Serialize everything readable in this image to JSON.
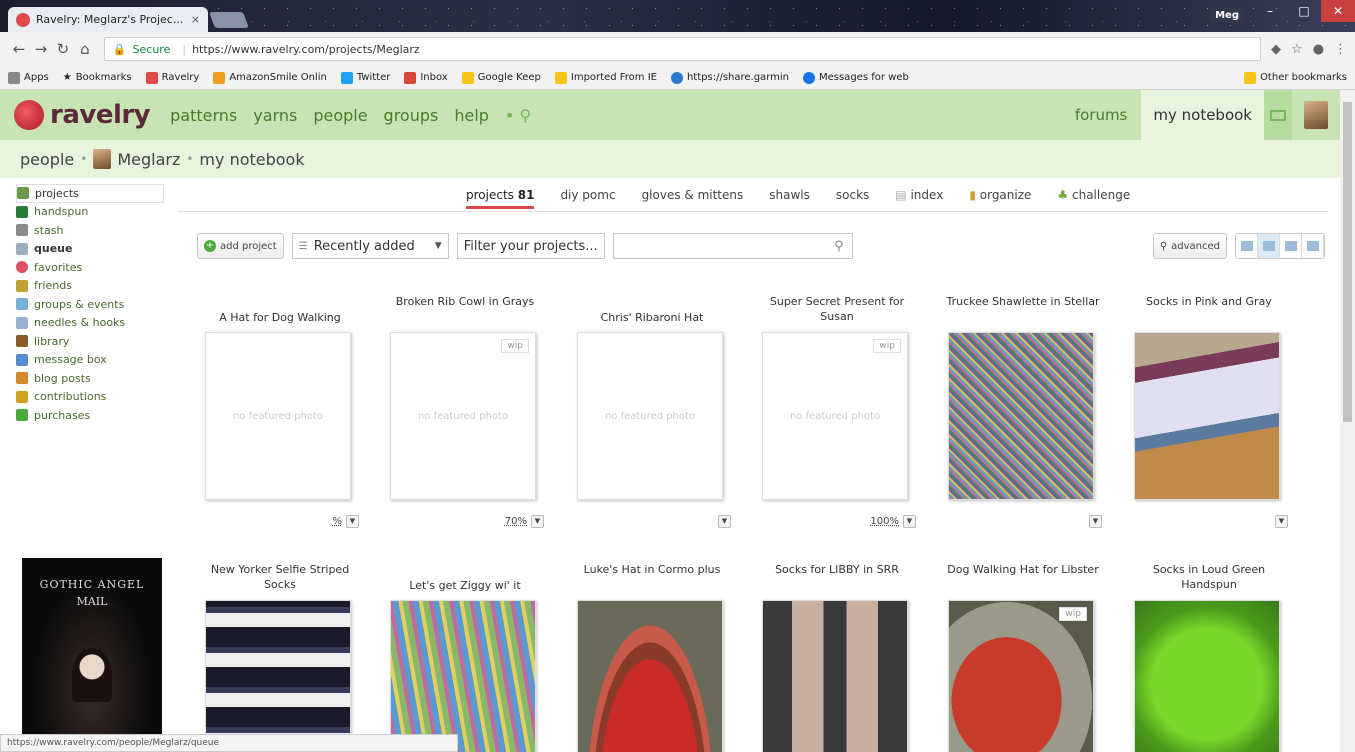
{
  "browser": {
    "tab_title": "Ravelry: Meglarz's Projec...",
    "tab_close": "×",
    "profile": "Meg",
    "secure_label": "Secure",
    "url": "https://www.ravelry.com/projects/Meglarz",
    "bookmarks": [
      {
        "label": "Apps",
        "color": "#888888"
      },
      {
        "label": "Bookmarks",
        "color": "#333333"
      },
      {
        "label": "Ravelry",
        "color": "#e24a4a"
      },
      {
        "label": "AmazonSmile Onlin",
        "color": "#f0a020"
      },
      {
        "label": "Twitter",
        "color": "#1da1f2"
      },
      {
        "label": "Inbox",
        "color": "#d44638"
      },
      {
        "label": "Google Keep",
        "color": "#f5c518"
      },
      {
        "label": "Imported From IE",
        "color": "#f5c518"
      },
      {
        "label": "https://share.garmin",
        "color": "#2a7ad0"
      },
      {
        "label": "Messages for web",
        "color": "#1a73e8"
      }
    ],
    "other_bookmarks": "Other bookmarks",
    "status_url": "https://www.ravelry.com/people/Meglarz/queue"
  },
  "header": {
    "logo": "ravelry",
    "nav": [
      "patterns",
      "yarns",
      "people",
      "groups",
      "help"
    ],
    "forums": "forums",
    "notebook": "my notebook"
  },
  "breadcrumb": {
    "people": "people",
    "user": "Meglarz",
    "notebook": "my notebook"
  },
  "sidebar": [
    {
      "label": "projects",
      "color": "#6a9a4a"
    },
    {
      "label": "handspun",
      "color": "#2a7a3a"
    },
    {
      "label": "stash",
      "color": "#8a8a8a"
    },
    {
      "label": "queue",
      "color": "#9ab0c0"
    },
    {
      "label": "favorites",
      "color": "#e05060"
    },
    {
      "label": "friends",
      "color": "#c0a030"
    },
    {
      "label": "groups & events",
      "color": "#7ab0d8"
    },
    {
      "label": "needles & hooks",
      "color": "#9ab0d0"
    },
    {
      "label": "library",
      "color": "#8a5a2a"
    },
    {
      "label": "message box",
      "color": "#5a8ad0"
    },
    {
      "label": "blog posts",
      "color": "#d08a2a"
    },
    {
      "label": "contributions",
      "color": "#d0a020"
    },
    {
      "label": "purchases",
      "color": "#4aaa3a"
    }
  ],
  "ad": {
    "line1": "GOTHIC ANGEL",
    "line2": "MAIL"
  },
  "tabs": {
    "projects_label": "projects",
    "projects_count": "81",
    "diy": "diy pomc",
    "gloves": "gloves & mittens",
    "shawls": "shawls",
    "socks": "socks",
    "index": "index",
    "organize": "organize",
    "challenge": "challenge"
  },
  "toolbar": {
    "add_project": "add project",
    "sort": "Recently added",
    "filter": "Filter your projects...",
    "advanced": "advanced"
  },
  "projects_row1": [
    {
      "title": "A Hat for Dog Walking",
      "photo": "no featured photo",
      "wip": "",
      "pct": "%"
    },
    {
      "title": "Broken Rib Cowl in Grays",
      "photo": "no featured photo",
      "wip": "wip",
      "pct": "70%"
    },
    {
      "title": "Chris' Ribaroni Hat",
      "photo": "no featured photo",
      "wip": "",
      "pct": ""
    },
    {
      "title": "Super Secret Present for Susan",
      "photo": "no featured photo",
      "wip": "wip",
      "pct": "100%"
    },
    {
      "title": "Truckee Shawlette in Stellar",
      "photo": "",
      "wip": "",
      "pct": ""
    },
    {
      "title": "Socks in Pink and Gray",
      "photo": "",
      "wip": "",
      "pct": ""
    }
  ],
  "projects_row2": [
    {
      "title": "New Yorker Selfie Striped Socks",
      "wip": ""
    },
    {
      "title": "Let's get Ziggy wi' it",
      "wip": ""
    },
    {
      "title": "Luke's Hat in Cormo plus",
      "wip": ""
    },
    {
      "title": "Socks for LIBBY in SRR",
      "wip": ""
    },
    {
      "title": "Dog Walking Hat for Libster",
      "wip": "wip"
    },
    {
      "title": "Socks in Loud Green Handspun",
      "wip": ""
    }
  ]
}
